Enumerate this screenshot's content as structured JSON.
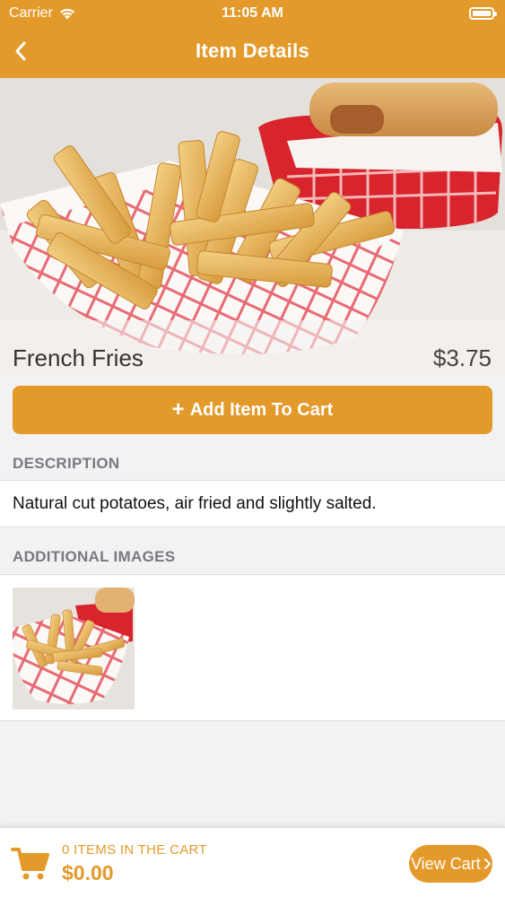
{
  "status_bar": {
    "carrier": "Carrier",
    "time": "11:05 AM"
  },
  "nav": {
    "title": "Item Details",
    "back_icon": "chevron-left-icon"
  },
  "item": {
    "name": "French Fries",
    "price": "$3.75"
  },
  "add_button": {
    "icon": "plus-icon",
    "label": "Add Item To Cart"
  },
  "description": {
    "heading": "DESCRIPTION",
    "text": "Natural cut potatoes, air fried and slightly salted."
  },
  "additional_images": {
    "heading": "ADDITIONAL IMAGES",
    "count": 1
  },
  "footer": {
    "cart_icon": "cart-icon",
    "items_label": "0 ITEMS IN THE CART",
    "total": "$0.00",
    "view_cart_label": "View Cart",
    "view_cart_icon": "chevron-right-icon"
  },
  "colors": {
    "accent": "#e39a2b",
    "background": "#f2f2f4",
    "section_heading": "#7a7a7e"
  }
}
